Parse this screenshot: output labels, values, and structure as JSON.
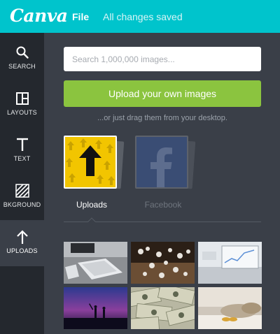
{
  "header": {
    "logo": "Canva",
    "file_menu": "File",
    "save_status": "All changes saved"
  },
  "sidebar": {
    "items": [
      {
        "label": "SEARCH",
        "icon": "search-icon"
      },
      {
        "label": "LAYOUTS",
        "icon": "layouts-icon"
      },
      {
        "label": "TEXT",
        "icon": "text-icon"
      },
      {
        "label": "BKGROUND",
        "icon": "background-icon"
      },
      {
        "label": "UPLOADS",
        "icon": "upload-arrow-icon",
        "active": true
      }
    ]
  },
  "main": {
    "search_placeholder": "Search 1,000,000 images...",
    "upload_button": "Upload your own images",
    "drag_hint": "...or just drag them from your desktop.",
    "sources": [
      {
        "label": "Uploads",
        "active": true
      },
      {
        "label": "Facebook",
        "active": false
      }
    ],
    "thumbnails": [
      "desk-keyboard-photo",
      "pearls-on-sand-photo",
      "laptop-chart-photo",
      "sunset-silhouettes-photo",
      "dollar-bills-photo",
      "bedroom-photo"
    ]
  },
  "colors": {
    "topbar": "#00c4cc",
    "sidebar": "#24282e",
    "panel": "#3a3f48",
    "upload_button": "#8bc43f",
    "uploads_tile": "#f2c500",
    "facebook": "#3b5998"
  }
}
